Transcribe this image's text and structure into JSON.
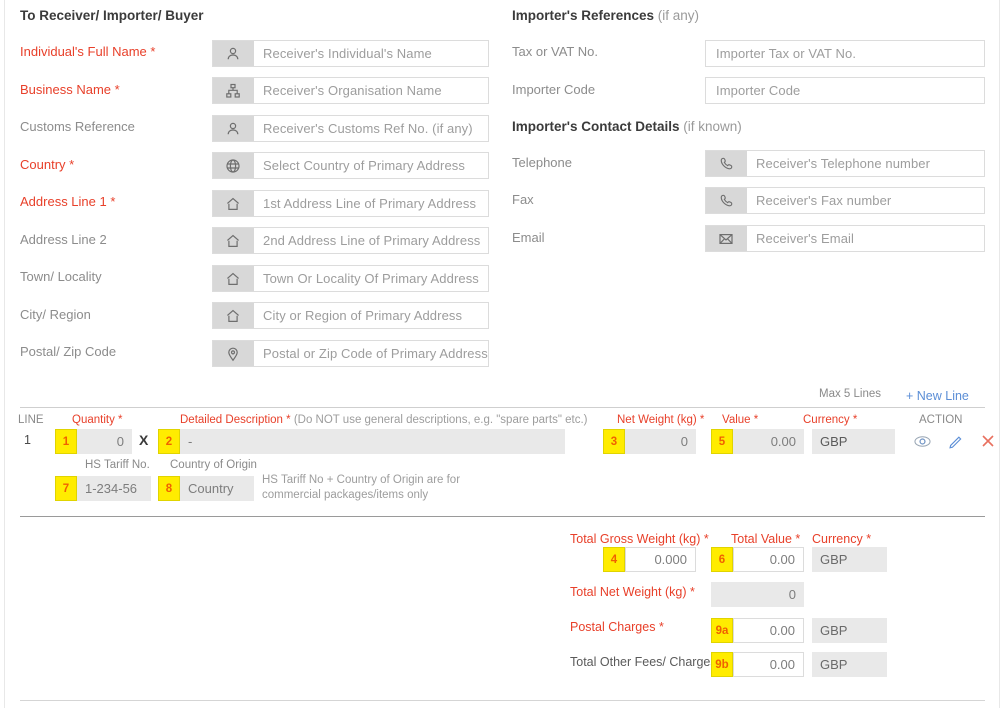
{
  "left_panel": {
    "title": "To Receiver/ Importer/ Buyer",
    "fields": [
      {
        "label": "Individual's Full Name",
        "required": true,
        "icon": "person-icon",
        "placeholder": "Receiver's Individual's Name"
      },
      {
        "label": "Business Name",
        "required": true,
        "icon": "org-chart-icon",
        "placeholder": "Receiver's Organisation Name"
      },
      {
        "label": "Customs Reference",
        "required": false,
        "icon": "person-icon",
        "placeholder": "Receiver's Customs Ref No. (if any)"
      },
      {
        "label": "Country",
        "required": true,
        "icon": "globe-icon",
        "placeholder": "Select Country of Primary Address"
      },
      {
        "label": "Address Line 1",
        "required": true,
        "icon": "home-icon",
        "placeholder": "1st Address Line of Primary Address"
      },
      {
        "label": "Address Line 2",
        "required": false,
        "icon": "home-icon",
        "placeholder": "2nd Address Line of Primary Address"
      },
      {
        "label": "Town/ Locality",
        "required": false,
        "icon": "home-icon",
        "placeholder": "Town Or Locality Of Primary Address"
      },
      {
        "label": "City/ Region",
        "required": false,
        "icon": "home-icon",
        "placeholder": "City or Region of Primary Address"
      },
      {
        "label": "Postal/ Zip Code",
        "required": false,
        "icon": "location-pin-icon",
        "placeholder": "Postal or Zip Code of Primary Address"
      }
    ]
  },
  "right_panel": {
    "references_title": "Importer's References",
    "references_subtitle": "(if any)",
    "reference_fields": [
      {
        "label": "Tax or VAT No.",
        "icon": null,
        "placeholder": "Importer Tax or VAT No."
      },
      {
        "label": "Importer Code",
        "icon": null,
        "placeholder": "Importer Code"
      }
    ],
    "contact_title": "Importer's Contact Details",
    "contact_subtitle": "(if known)",
    "contact_fields": [
      {
        "label": "Telephone",
        "icon": "phone-icon",
        "placeholder": "Receiver's Telephone number"
      },
      {
        "label": "Fax",
        "icon": "phone-icon",
        "placeholder": "Receiver's Fax number"
      },
      {
        "label": "Email",
        "icon": "envelope-icon",
        "placeholder": "Receiver's Email"
      }
    ]
  },
  "lines_table": {
    "max_lines_note": "Max 5 Lines",
    "new_line_label": "+ New Line",
    "headers": {
      "line": "LINE",
      "quantity": "Quantity",
      "description": "Detailed Description",
      "description_note": "(Do NOT use general descriptions, e.g. \"spare parts\" etc.)",
      "net_weight": "Net Weight (kg)",
      "value": "Value",
      "currency": "Currency",
      "action": "ACTION",
      "hs_tariff": "HS Tariff No.",
      "country_of_origin": "Country of Origin"
    },
    "row": {
      "line_no": "1",
      "quantity_badge": "1",
      "quantity_value": "0",
      "multiply_symbol": "X",
      "description_badge": "2",
      "description_value": "-",
      "net_weight_badge": "3",
      "net_weight_value": "0",
      "value_badge": "5",
      "value_value": "0.00",
      "currency_value": "GBP",
      "hs_tariff_badge": "7",
      "hs_tariff_value": "1-234-56",
      "country_badge": "8",
      "country_value": "Country",
      "hint": "HS Tariff No + Country of Origin are for commercial packages/items only"
    },
    "actions": [
      {
        "name": "view-icon"
      },
      {
        "name": "edit-icon"
      },
      {
        "name": "delete-icon"
      }
    ]
  },
  "totals": {
    "gross_weight_label": "Total Gross Weight (kg)",
    "gross_weight_badge": "4",
    "gross_weight_value": "0.000",
    "total_value_label": "Total Value",
    "total_value_badge": "6",
    "total_value_value": "0.00",
    "currency_label": "Currency",
    "currency_value_1": "GBP",
    "net_weight_label": "Total Net Weight (kg)",
    "net_weight_value": "0",
    "postal_charges_label": "Postal Charges",
    "postal_charges_badge": "9a",
    "postal_charges_value": "0.00",
    "postal_charges_currency": "GBP",
    "other_fees_label": "Total Other Fees/ Charges",
    "other_fees_badge": "9b",
    "other_fees_value": "0.00",
    "other_fees_currency": "GBP"
  },
  "colors": {
    "required_red": "#e8402a",
    "badge_yellow": "#ffec00",
    "badge_text": "#f06000",
    "link_blue": "#5b8ed6",
    "delete_red": "#e8705f"
  }
}
